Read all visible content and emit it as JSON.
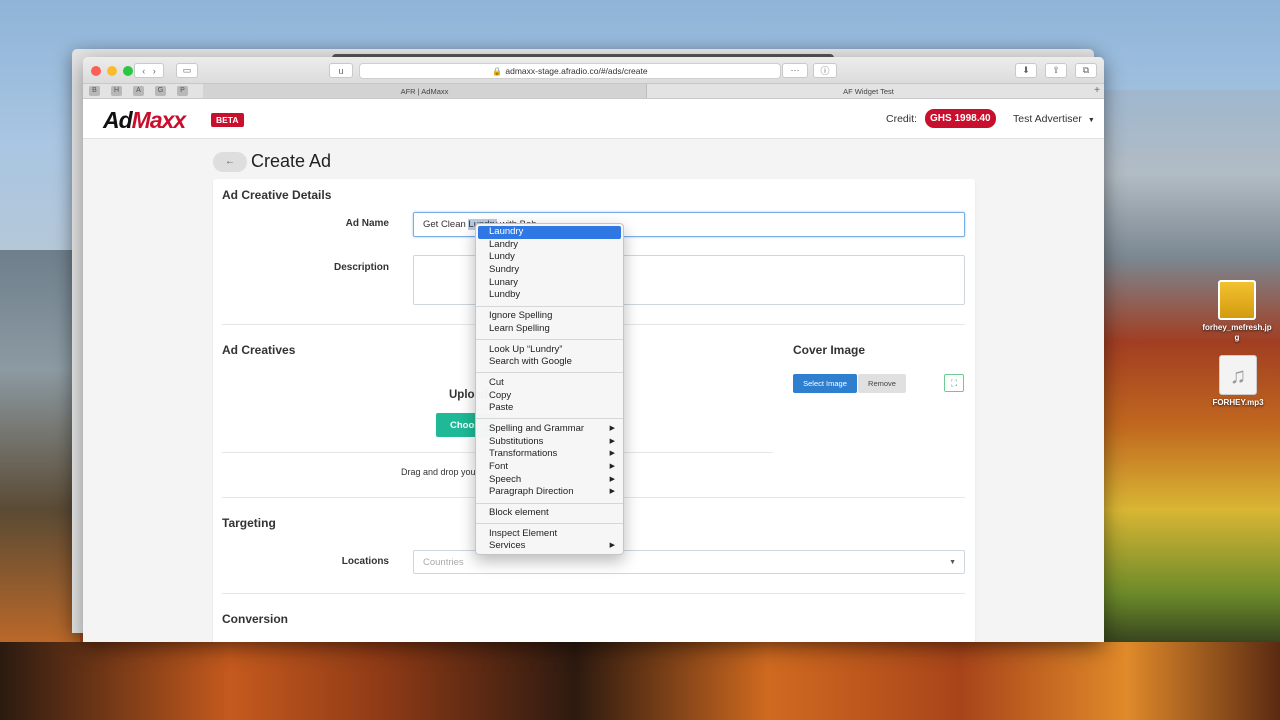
{
  "browser": {
    "url_short": "u",
    "url": "admaxx-stage.afradio.co/#/ads/create",
    "bookmark_letters": [
      "B",
      "H",
      "A",
      "G",
      "P"
    ],
    "tabs": [
      {
        "label": "AFR | AdMaxx"
      },
      {
        "label": "AF Widget Test"
      }
    ],
    "new_tab": "+"
  },
  "nav": {
    "logo_ad": "Ad",
    "logo_maxx": "Maxx",
    "beta": "BETA",
    "credit_label": "Credit:",
    "credit_value": "GHS 1998.40",
    "user": "Test Advertiser"
  },
  "page": {
    "back": "←",
    "title": "Create Ad"
  },
  "details": {
    "title": "Ad Creative Details",
    "ad_name_label": "Ad Name",
    "ad_name_prefix": "Get Clean ",
    "ad_name_selected": "Lundry",
    "ad_name_suffix": " with Bob",
    "description_label": "Description"
  },
  "creatives": {
    "title": "Ad Creatives",
    "upload_title": "Upload",
    "choose_btn": "Choose",
    "drag_text": "Drag and drop your",
    "cover_title": "Cover Image",
    "select_image": "Select Image",
    "remove": "Remove"
  },
  "targeting": {
    "title": "Targeting",
    "locations_label": "Locations",
    "locations_placeholder": "Countries"
  },
  "conversion": {
    "title": "Conversion"
  },
  "context_menu": {
    "suggestions": [
      "Laundry",
      "Landry",
      "Lundy",
      "Sundry",
      "Lunary",
      "Lundby"
    ],
    "spelling": [
      "Ignore Spelling",
      "Learn Spelling"
    ],
    "lookup": [
      "Look Up “Lundry”",
      "Search with Google"
    ],
    "edit": [
      "Cut",
      "Copy",
      "Paste"
    ],
    "submenus": [
      "Spelling and Grammar",
      "Substitutions",
      "Transformations",
      "Font",
      "Speech",
      "Paragraph Direction"
    ],
    "block": [
      "Block element"
    ],
    "inspect": [
      "Inspect Element",
      "Services"
    ],
    "arrow": "▶"
  },
  "desktop": {
    "files": [
      {
        "name_line1": "forhey_mefresh.jp",
        "name_line2": "g"
      },
      {
        "name_line1": "FORHEY.mp3",
        "name_line2": ""
      }
    ]
  }
}
